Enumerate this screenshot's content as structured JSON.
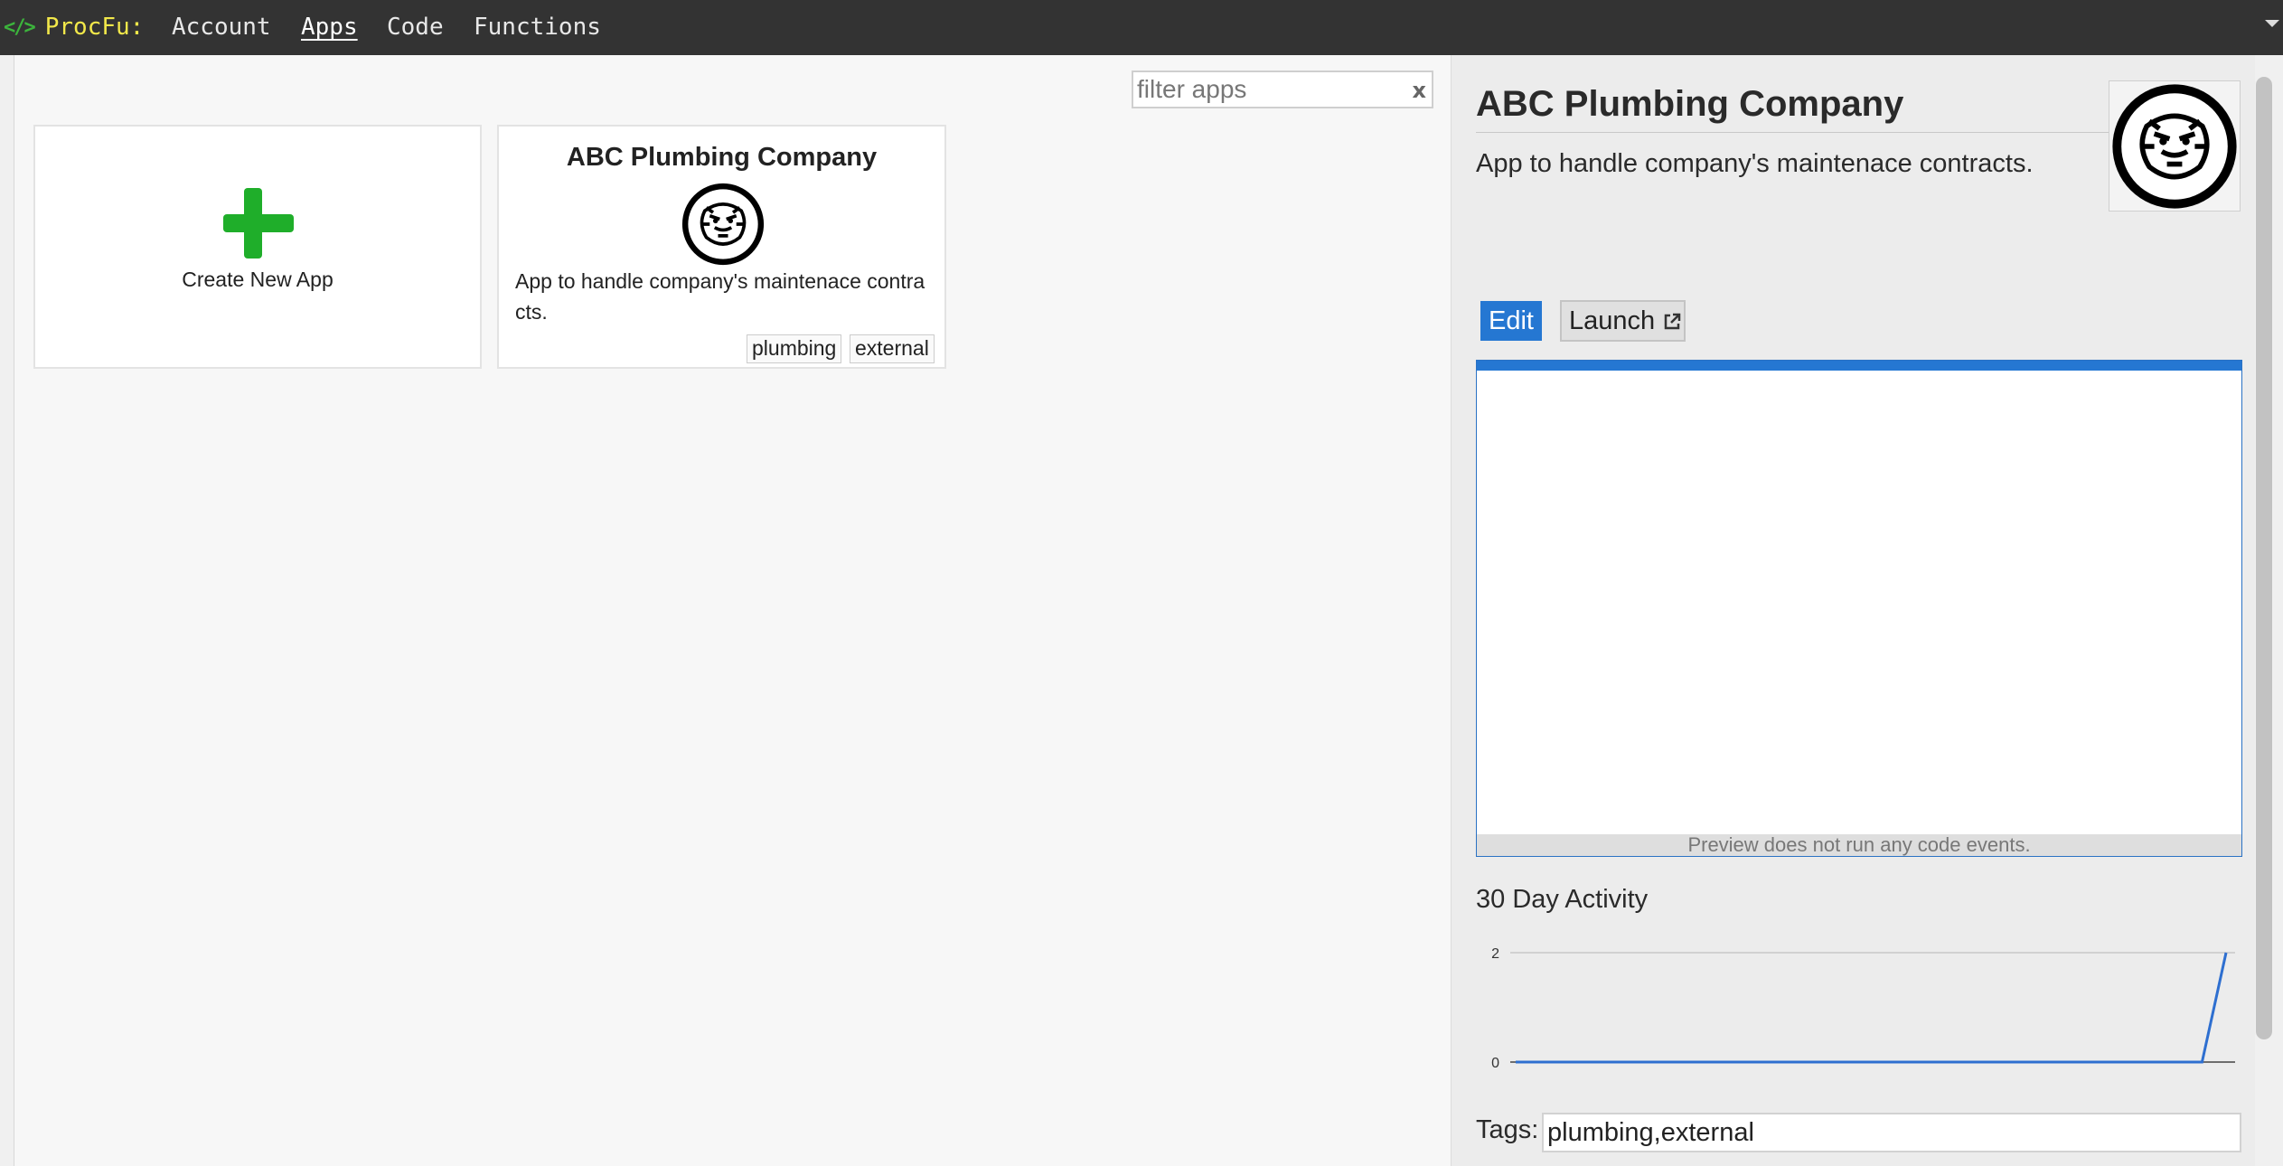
{
  "nav": {
    "brand": "ProcFu:",
    "brand_icon": "code-icon",
    "links": [
      "Account",
      "Apps",
      "Code",
      "Functions"
    ],
    "active": "Apps"
  },
  "filter": {
    "placeholder": "filter apps",
    "clear_label": "x"
  },
  "cards": {
    "new_app_label": "Create New App",
    "app": {
      "title": "ABC Plumbing Company",
      "description": "App to handle company's maintenace contracts.",
      "tags": [
        "plumbing",
        "external"
      ]
    }
  },
  "detail": {
    "title": "ABC Plumbing Company",
    "description": "App to handle company's maintenace contracts.",
    "edit_label": "Edit",
    "launch_label": "Launch",
    "preview_note": "Preview does not run any code events.",
    "activity_title": "30 Day Activity",
    "tags_label": "Tags:",
    "tags_value": "plumbing,external"
  },
  "chart_data": {
    "type": "line",
    "title": "",
    "xlabel": "",
    "ylabel": "",
    "ylim": [
      0,
      2
    ],
    "y_ticks": [
      "2",
      "0"
    ],
    "x": [
      1,
      2,
      3,
      4,
      5,
      6,
      7,
      8,
      9,
      10,
      11,
      12,
      13,
      14,
      15,
      16,
      17,
      18,
      19,
      20,
      21,
      22,
      23,
      24,
      25,
      26,
      27,
      28,
      29,
      30
    ],
    "series": [
      {
        "values": [
          0,
          0,
          0,
          0,
          0,
          0,
          0,
          0,
          0,
          0,
          0,
          0,
          0,
          0,
          0,
          0,
          0,
          0,
          0,
          0,
          0,
          0,
          0,
          0,
          0,
          0,
          0,
          0,
          0,
          2
        ]
      }
    ],
    "grid": true,
    "color": "#2e6fd0"
  },
  "colors": {
    "accent": "#2577d2",
    "plus": "#1fae2a",
    "brand": "#f2e84a",
    "topbar": "#333333"
  }
}
